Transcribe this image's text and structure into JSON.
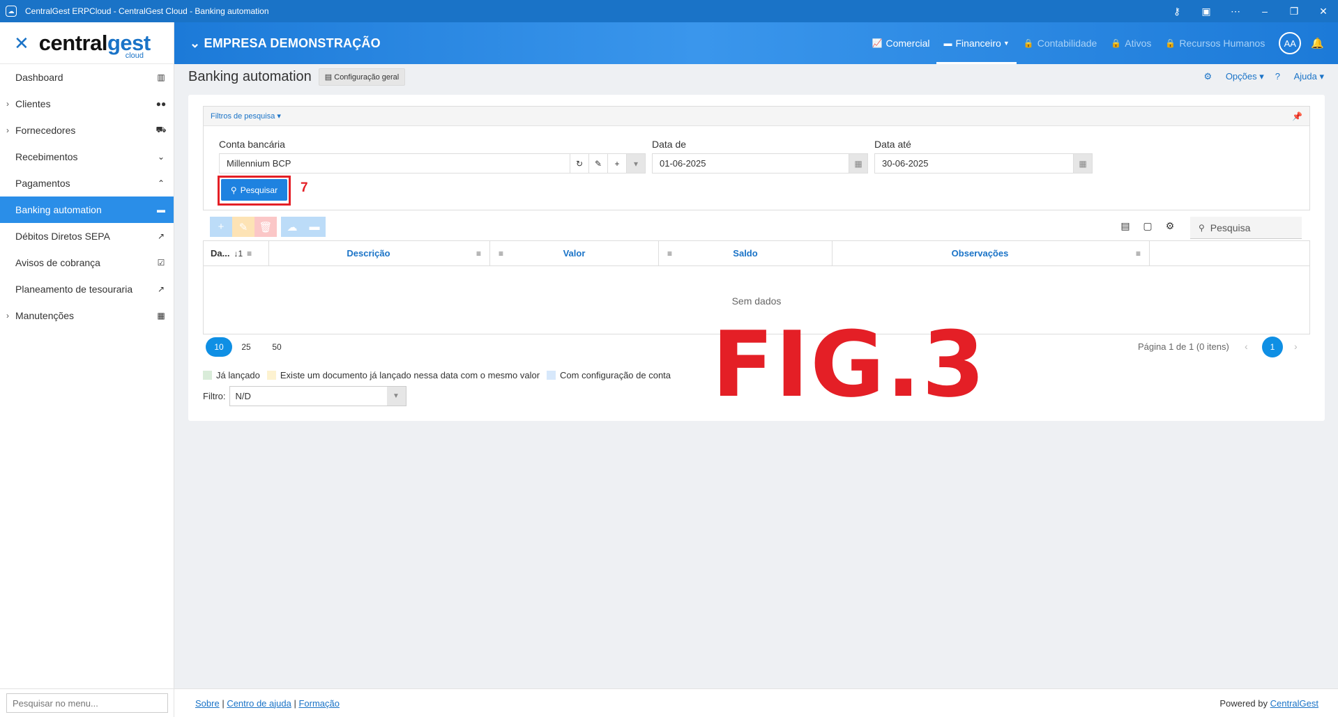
{
  "window": {
    "title": "CentralGest ERPCloud - CentralGest Cloud - Banking automation"
  },
  "logo": {
    "central": "central",
    "gest": "gest",
    "cloud": "cloud"
  },
  "sidebar": {
    "items": [
      {
        "label": "Dashboard",
        "icon": "bar-chart-icon"
      },
      {
        "label": "Clientes",
        "icon": "users-icon",
        "expandable": true
      },
      {
        "label": "Fornecedores",
        "icon": "truck-icon",
        "expandable": true
      },
      {
        "label": "Recebimentos",
        "icon": "circle-down-icon"
      },
      {
        "label": "Pagamentos",
        "icon": "circle-up-icon"
      },
      {
        "label": "Banking automation",
        "icon": "credit-card-icon",
        "active": true
      },
      {
        "label": "Débitos Diretos SEPA",
        "icon": "external-link-icon"
      },
      {
        "label": "Avisos de cobrança",
        "icon": "calendar-check-icon"
      },
      {
        "label": "Planeamento de tesouraria",
        "icon": "line-chart-icon"
      },
      {
        "label": "Manutenções",
        "icon": "table-icon",
        "expandable": true
      }
    ],
    "search_placeholder": "Pesquisar no menu..."
  },
  "header": {
    "company": "EMPRESA DEMONSTRAÇÃO",
    "nav": [
      {
        "label": "Comercial",
        "locked": false
      },
      {
        "label": "Financeiro",
        "locked": false,
        "active": true
      },
      {
        "label": "Contabilidade",
        "locked": true
      },
      {
        "label": "Ativos",
        "locked": true
      },
      {
        "label": "Recursos Humanos",
        "locked": true
      }
    ],
    "avatar": "AA"
  },
  "page": {
    "title": "Banking automation",
    "config_button": "Configuração geral",
    "options": "Opções",
    "help": "Ajuda"
  },
  "filters": {
    "header": "Filtros de pesquisa",
    "conta_label": "Conta bancária",
    "conta_value": "Millennium BCP",
    "data_de_label": "Data de",
    "data_de_value": "01-06-2025",
    "data_ate_label": "Data até",
    "data_ate_value": "30-06-2025",
    "search_button": "Pesquisar",
    "annotation": "7"
  },
  "grid": {
    "search_placeholder": "Pesquisa",
    "columns": [
      "Da...",
      "Descrição",
      "Valor",
      "Saldo",
      "Observações"
    ],
    "sort_indicator": "↓1",
    "empty": "Sem dados",
    "page_sizes": [
      "10",
      "25",
      "50"
    ],
    "selected_page_size": "10",
    "page_info": "Página 1 de 1 (0 itens)",
    "current_page": "1"
  },
  "legend": [
    {
      "label": "Já lançado",
      "color": "#d9ecd9"
    },
    {
      "label": "Existe um documento já lançado nessa data com o mesmo valor",
      "color": "#fdf2d0"
    },
    {
      "label": "Com configuração de conta",
      "color": "#d7e8fb"
    }
  ],
  "filtro": {
    "label": "Filtro:",
    "value": "N/D"
  },
  "figure_label": "FIG.3",
  "footer": {
    "sobre": "Sobre",
    "centro": "Centro de ajuda",
    "formacao": "Formação",
    "powered_prefix": "Powered by",
    "powered_link": "CentralGest"
  },
  "colors": {
    "primary": "#1a73c7",
    "active_nav": "#2a8ee8",
    "annotation": "#e41f26"
  }
}
